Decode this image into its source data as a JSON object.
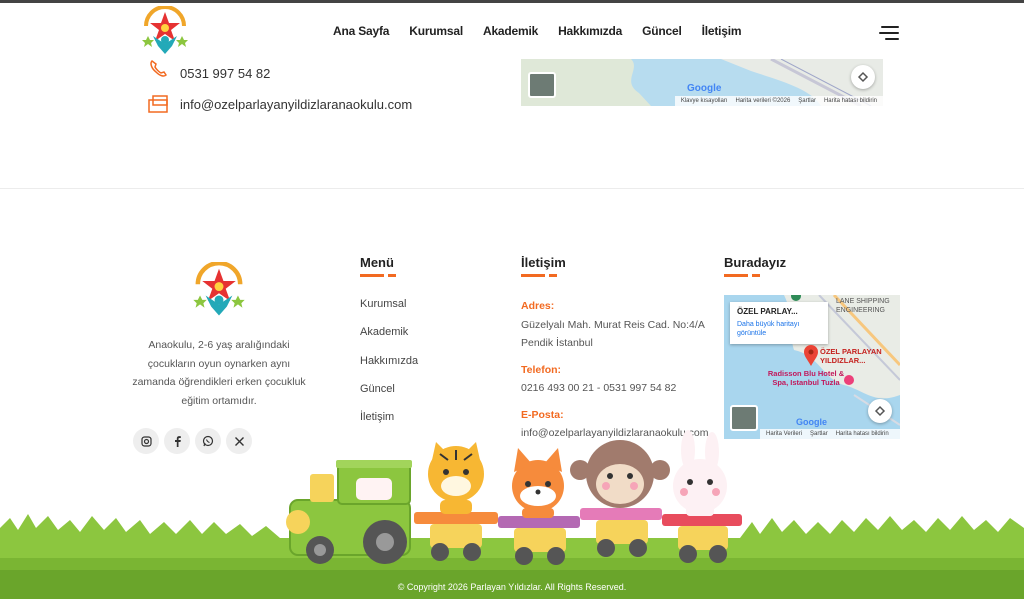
{
  "nav": {
    "items": [
      "Ana Sayfa",
      "Kurumsal",
      "Akademik",
      "Hakkımızda",
      "Güncel",
      "İletişim"
    ]
  },
  "contact_top": {
    "phone": "0531 997 54 82",
    "email": "info@ozelparlayanyildizlaranaokulu.com"
  },
  "map_top": {
    "google": "Google",
    "footer": [
      "Klavye kısayolları",
      "Harita verileri ©2026",
      "Şartlar",
      "Harita hatası bildirin"
    ]
  },
  "footer": {
    "about": "Anaokulu, 2-6 yaş aralığındaki çocukların oyun oynarken aynı zamanda öğrendikleri erken çocukluk eğitim ortamıdır.",
    "socials": [
      "instagram-icon",
      "facebook-icon",
      "whatsapp-icon",
      "x-icon"
    ],
    "menu_title": "Menü",
    "menu_items": [
      "Kurumsal",
      "Akademik",
      "Hakkımızda",
      "Güncel",
      "İletişim"
    ],
    "contact_title": "İletişim",
    "address_label": "Adres:",
    "address": "Güzelyalı Mah. Murat Reis Cad. No:4/A Pendik İstanbul",
    "phone_label": "Telefon:",
    "phone": "0216 493 00 21 - 0531 997 54 82",
    "email_label": "E-Posta:",
    "email": "info@ozelparlayanyildizlaranaokulu.com",
    "map_title": "Buradayız",
    "map_card_title": "ÖZEL PARLAY...",
    "map_card_link": "Daha büyük haritayı görüntüle",
    "map_labels": {
      "lane": "LANE SHIPPING ENGINEERING",
      "place": "ÖZEL PARLAYAN YILDIZLAR...",
      "hotel": "Radisson Blu Hotel & Spa, Istanbul Tuzla",
      "google": "Google"
    },
    "map_footer": [
      "Harita Verileri",
      "Şartlar",
      "Harita hatası bildirin"
    ],
    "copyright": "© Copyright 2026 Parlayan Yıldızlar. All Rights Reserved."
  },
  "colors": {
    "accent": "#f26a21",
    "grass": "#8cc63f",
    "grass_dark": "#6aa52b"
  }
}
